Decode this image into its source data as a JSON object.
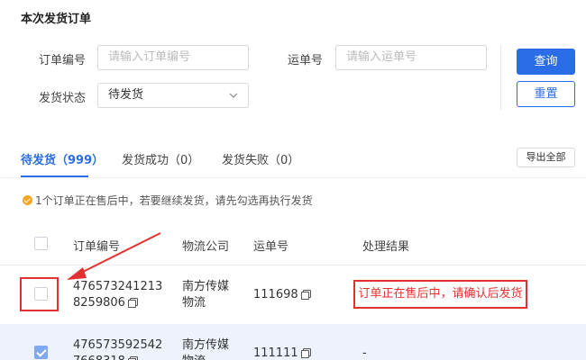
{
  "page": {
    "title": "本次发货订单"
  },
  "filters": {
    "order_no": {
      "label": "订单编号",
      "placeholder": "请输入订单编号"
    },
    "waybill_no": {
      "label": "运单号",
      "placeholder": "请输入运单号"
    },
    "ship_status": {
      "label": "发货状态",
      "value": "待发货"
    }
  },
  "buttons": {
    "query": "查询",
    "reset": "重置",
    "export_all": "导出全部"
  },
  "tabs": [
    {
      "label": "待发货（999）",
      "active": true
    },
    {
      "label": "发货成功（0）",
      "active": false
    },
    {
      "label": "发货失败（0）",
      "active": false
    }
  ],
  "notice": "1个订单正在售后中，若要继续发货，请先勾选再执行发货",
  "table": {
    "headers": [
      "订单编号",
      "物流公司",
      "运单号",
      "处理结果"
    ],
    "rows": [
      {
        "checked": false,
        "order_no_line1": "476573241213",
        "order_no_line2": "8259806",
        "logistics_line1": "南方传媒",
        "logistics_line2": "物流",
        "waybill": "111698",
        "result": "订单正在售后中，请确认后发货"
      },
      {
        "checked": true,
        "order_no_line1": "476573592542",
        "order_no_line2": "7668318",
        "logistics_line1": "南方传媒",
        "logistics_line2": "物流",
        "waybill": "111111",
        "result": "-"
      }
    ]
  },
  "colors": {
    "accent": "#2a6de6",
    "warning": "#e23131",
    "notice_icon": "#f5a623",
    "selected_row": "#edf2fc"
  },
  "icons": [
    "copy-icon",
    "chevron-down-icon",
    "check-circle-icon",
    "arrow-annotation"
  ]
}
